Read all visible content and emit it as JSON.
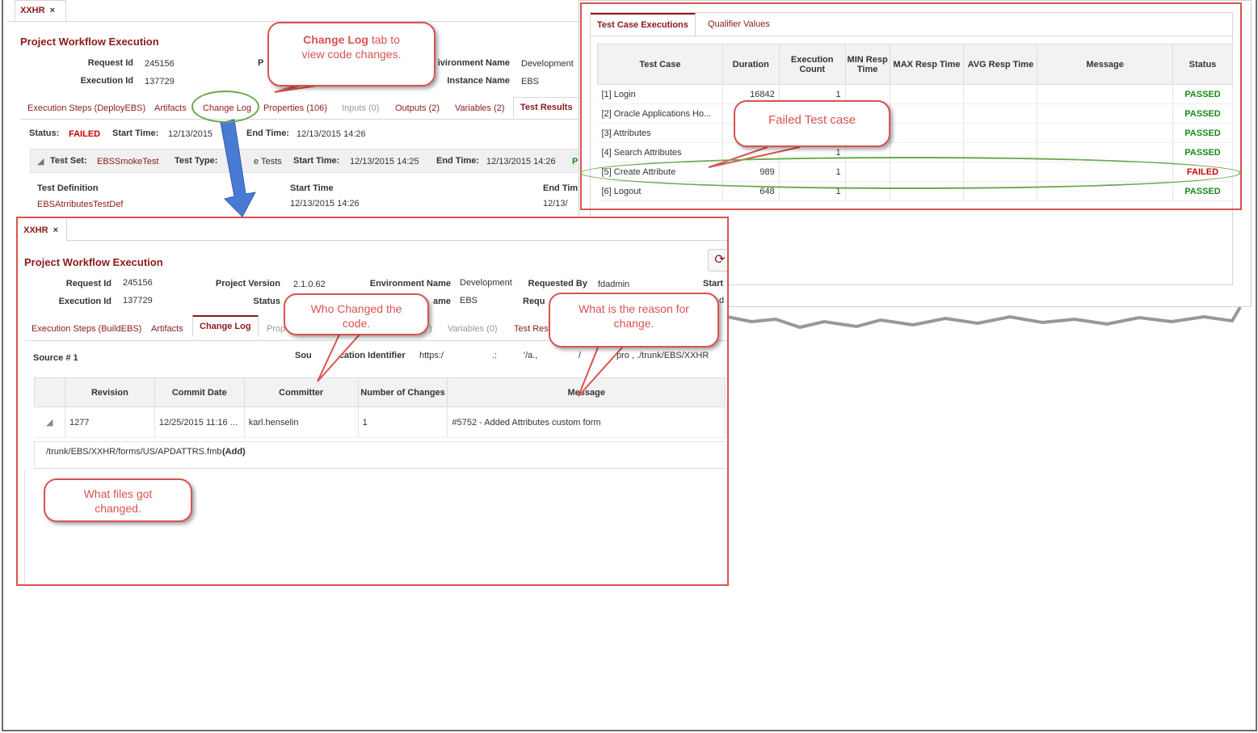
{
  "back": {
    "tab_label": "XXHR",
    "close": "×",
    "title": "Project Workflow Execution",
    "request_id_label": "Request Id",
    "request_id": "245156",
    "execution_id_label": "Execution Id",
    "execution_id": "137729",
    "partial_label_p": "P",
    "env_label": "ivironment Name",
    "env_value": "Development",
    "instance_label": "Instance Name",
    "instance_value": "EBS",
    "tabs": [
      "Execution Steps (DeployEBS)",
      "Artifacts",
      "Change Log",
      "Properties (106)",
      "Inputs (0)",
      "Outputs (2)",
      "Variables (2)",
      "Test Results"
    ],
    "status_label": "Status:",
    "status_value": "FAILED",
    "start_time_label": "Start Time:",
    "start_time_value": "12/13/2015",
    "end_time_label": "End Time:",
    "end_time_value": "12/13/2015 14:26",
    "testset_label": "Test Set:",
    "testset_value": "EBSSmokeTest",
    "testtype_label": "Test Type:",
    "testtype_value": "e Tests",
    "ts_start_label": "Start Time:",
    "ts_start_value": "12/13/2015 14:25",
    "ts_end_label": "End Time:",
    "ts_end_value": "12/13/2015 14:26",
    "ts_status_partial": "P",
    "def_header": "Test Definition",
    "def_start_header": "Start Time",
    "def_end_header": "End Tim",
    "def_name": "EBSAtrributesTestDef",
    "def_start": "12/13/2015 14:26",
    "def_end": "12/13/"
  },
  "right": {
    "tabs": [
      "Test Case Executions",
      "Qualifier Values"
    ],
    "columns": [
      "Test Case",
      "Duration",
      "Execution Count",
      "MIN Resp Time",
      "MAX Resp Time",
      "AVG Resp Time",
      "Message",
      "Status"
    ],
    "rows": [
      {
        "name": "[1] Login",
        "duration": "16842",
        "count": "1",
        "status": "PASSED"
      },
      {
        "name": "[2] Oracle Applications Ho...",
        "duration": "",
        "count": "",
        "status": "PASSED"
      },
      {
        "name": "[3] Attributes",
        "duration": "",
        "count": "",
        "status": "PASSED"
      },
      {
        "name": "[4] Search Attributes",
        "duration": "",
        "count": "1",
        "status": "PASSED"
      },
      {
        "name": "[5] Create Attribute",
        "duration": "989",
        "count": "1",
        "status": "FAILED"
      },
      {
        "name": "[6] Logout",
        "duration": "648",
        "count": "1",
        "status": "PASSED"
      }
    ]
  },
  "front": {
    "tab_label": "XXHR",
    "close": "×",
    "title": "Project Workflow Execution",
    "request_id_label": "Request Id",
    "request_id": "245156",
    "execution_id_label": "Execution Id",
    "execution_id": "137729",
    "project_version_label": "Project Version",
    "project_version": "2.1.0.62",
    "status_label": "Status",
    "env_label": "Environment Name",
    "env_value": "Development",
    "instance_label": "ame",
    "instance_value": "EBS",
    "requested_by_label": "Requested By",
    "requested_by": "fdadmin",
    "start_partial": "Start",
    "requ_partial": "Requ",
    "d_partial": "d",
    "tabs": [
      "Execution Steps (BuildEBS)",
      "Artifacts",
      "Change Log",
      "Prop",
      "Variables (0)",
      "Test Resu"
    ],
    "tab_partial_paren": ")",
    "source_label": "Source # 1",
    "source_id_label": "Sou",
    "source_id_label2": "ocation Identifier",
    "source_url_start": "https:/",
    "source_url_mid1": ".:",
    "source_url_mid2": "'/a.,",
    "source_url_mid3": "/",
    "source_url_end": "pro  , ./trunk/EBS/XXHR",
    "columns": [
      "Revision",
      "Commit Date",
      "Committer",
      "Number of Changes",
      "Message"
    ],
    "row": {
      "revision": "1277",
      "date": "12/25/2015 11:16 ...",
      "committer": "karl.henselin",
      "changes": "1",
      "message": "#5752 - Added Attributes custom form"
    },
    "file_path": "/trunk/EBS/XXHR/forms/US/APDATTRS.fmb",
    "file_action": "(Add)",
    "refresh_glyph": "⟳"
  },
  "callouts": {
    "change_log_bold": "Change Log",
    "change_log_rest1": " tab to",
    "change_log_rest2": "view code changes.",
    "failed_case": "Failed Test case",
    "who_changed1": "Who Changed the",
    "who_changed2": "code.",
    "reason1": "What is the reason for",
    "reason2": "change.",
    "files1": "What files got",
    "files2": "changed."
  },
  "colors": {
    "accent": "#8b1a1a",
    "callout": "#d9534f",
    "ellipse": "#6aa84f",
    "arrow": "#4a7bd4",
    "passed": "#1a8a1a",
    "failed": "#cc0000"
  }
}
